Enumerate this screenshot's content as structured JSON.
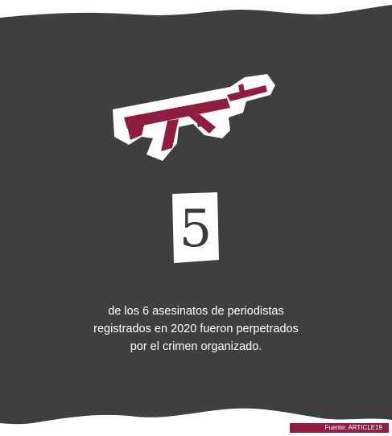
{
  "statistic": {
    "number": "5",
    "caption_lines": [
      "de los 6 asesinatos de periodistas",
      "registrados en 2020 fueron perpetrados",
      "por el crimen organizado."
    ]
  },
  "source": {
    "text": "Fuente: ARTICLE19"
  },
  "icon": {
    "name": "assault-rifle-icon"
  },
  "colors": {
    "background_panel": "#3f3f3f",
    "accent": "#8f1d3f",
    "text": "#ffffff"
  }
}
